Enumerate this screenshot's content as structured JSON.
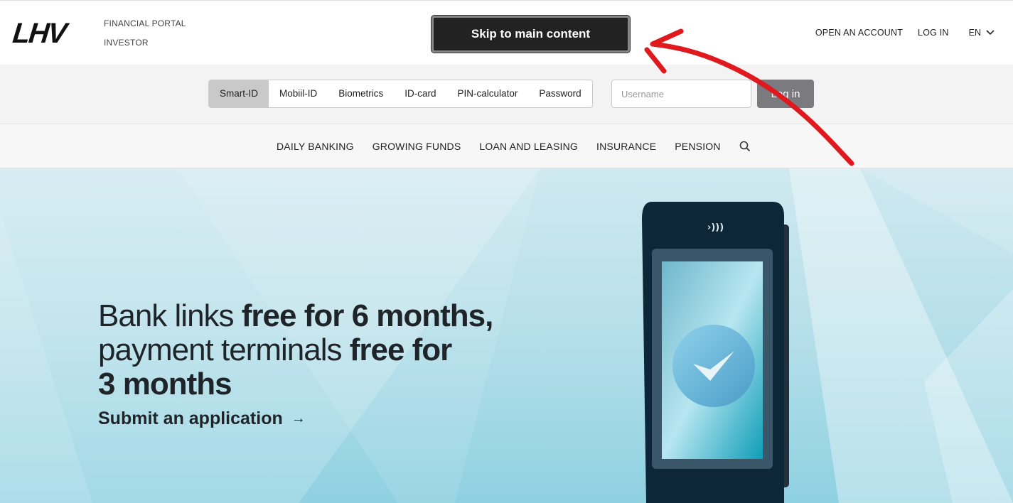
{
  "header": {
    "logo": "LHV",
    "portal_links": [
      "FINANCIAL PORTAL",
      "INVESTOR"
    ],
    "skip_link": "Skip to main content",
    "open_account": "OPEN AN ACCOUNT",
    "log_in": "LOG IN",
    "language": "EN"
  },
  "login": {
    "methods": [
      "Smart-ID",
      "Mobiil-ID",
      "Biometrics",
      "ID-card",
      "PIN-calculator",
      "Password"
    ],
    "active_method": "Smart-ID",
    "username_placeholder": "Username",
    "username_value": "",
    "submit_label": "Log in"
  },
  "nav": {
    "items": [
      "DAILY BANKING",
      "GROWING FUNDS",
      "LOAN AND LEASING",
      "INSURANCE",
      "PENSION"
    ],
    "search_icon": "search-icon"
  },
  "hero": {
    "line1_light": "Bank links ",
    "line1_bold": "free for 6 months,",
    "line2_light": "payment terminals ",
    "line2_bold": "free for",
    "line3_bold": "3 months",
    "cta": "Submit an application",
    "cta_icon": "arrow-right-icon"
  },
  "colors": {
    "skip_bg": "#222222",
    "login_button": "#7a7a7f",
    "hero_top": "#cfe9f0",
    "hero_bottom": "#8fd1e1",
    "annotation": "#e0191f"
  }
}
